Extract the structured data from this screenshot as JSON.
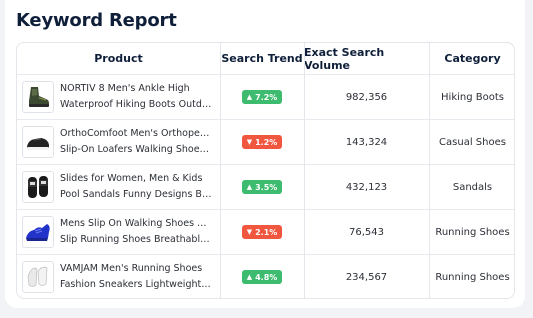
{
  "report": {
    "title": "Keyword Report",
    "columns": [
      "Product",
      "Search Trend",
      "Exact Search Volume",
      "Category"
    ],
    "rows": [
      {
        "name_line1": "NORTIV 8 Men's Ankle High",
        "name_line2": "Waterproof Hiking Boots Outdo...",
        "image_icon": "hiking-boot-icon",
        "trend": "7.2%",
        "trend_direction": "up",
        "volume": "982,356",
        "category": "Hiking Boots"
      },
      {
        "name_line1": "OrthoComfoot Men's Orthopedic",
        "name_line2": "Slip-On Loafers Walking Shoes w...",
        "image_icon": "loafer-shoe-icon",
        "trend": "1.2%",
        "trend_direction": "down",
        "volume": "143,324",
        "category": "Casual Shoes"
      },
      {
        "name_line1": "Slides for Women, Men & Kids",
        "name_line2": "Pool Sandals Funny Designs Boo...",
        "image_icon": "slide-sandal-icon",
        "trend": "3.5%",
        "trend_direction": "up",
        "volume": "432,123",
        "category": "Sandals"
      },
      {
        "name_line1": "Mens Slip On Walking Shoes Non",
        "name_line2": "Slip Running Shoes Breathable ...",
        "image_icon": "running-shoe-icon",
        "trend": "2.1%",
        "trend_direction": "down",
        "volume": "76,543",
        "category": "Running Shoes"
      },
      {
        "name_line1": "VAMJAM Men's Running Shoes",
        "name_line2": "Fashion Sneakers Lightweight Br...",
        "image_icon": "white-sneaker-icon",
        "trend": "4.8%",
        "trend_direction": "up",
        "volume": "234,567",
        "category": "Running Shoes"
      }
    ]
  },
  "colors": {
    "trend_up": "#3dbb6f",
    "trend_down": "#f1573f"
  }
}
